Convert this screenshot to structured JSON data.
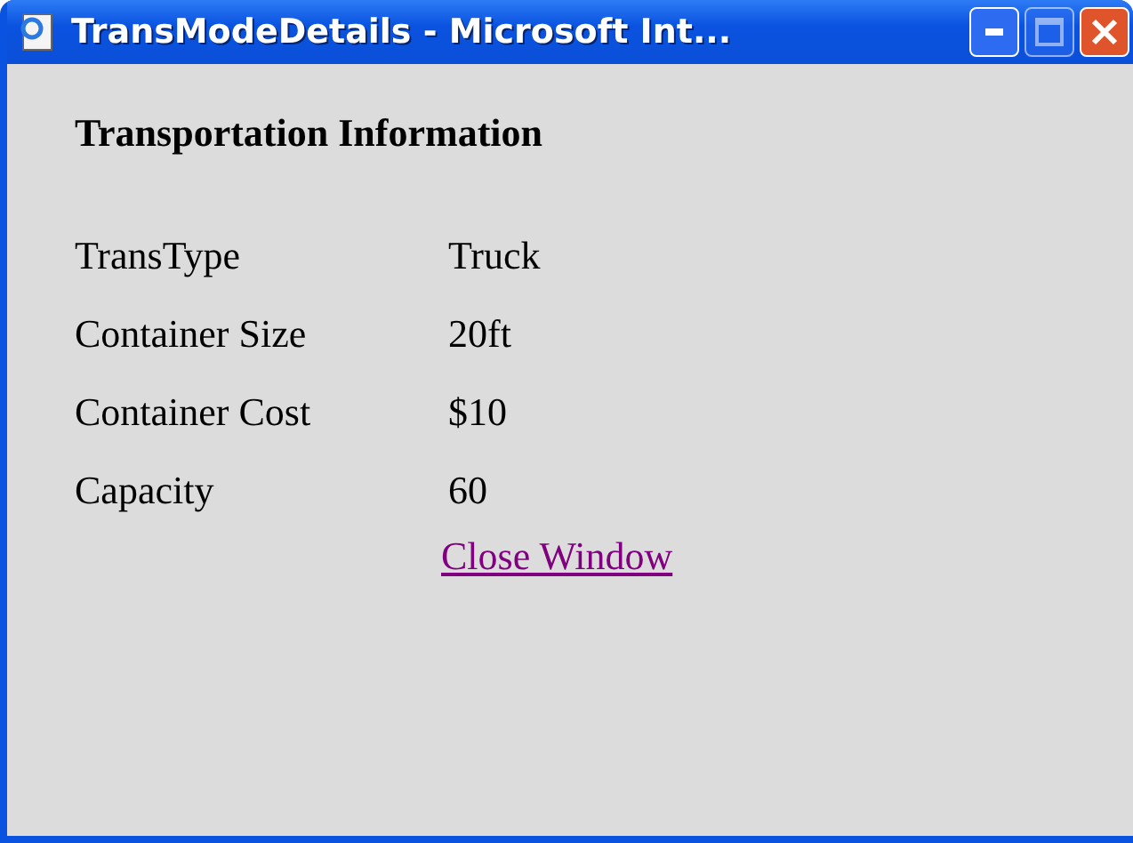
{
  "window": {
    "title": "TransModeDetails - Microsoft Int...",
    "controls": [
      {
        "kind": "minimize",
        "disabled": false
      },
      {
        "kind": "maximize",
        "disabled": true
      },
      {
        "kind": "close",
        "disabled": false
      }
    ]
  },
  "heading": "Transportation Information",
  "details": [
    {
      "label": "TransType",
      "value": "Truck"
    },
    {
      "label": "Container Size",
      "value": "20ft"
    },
    {
      "label": "Container Cost",
      "value": "$10"
    },
    {
      "label": "Capacity",
      "value": "60"
    }
  ],
  "link": "Close Window"
}
